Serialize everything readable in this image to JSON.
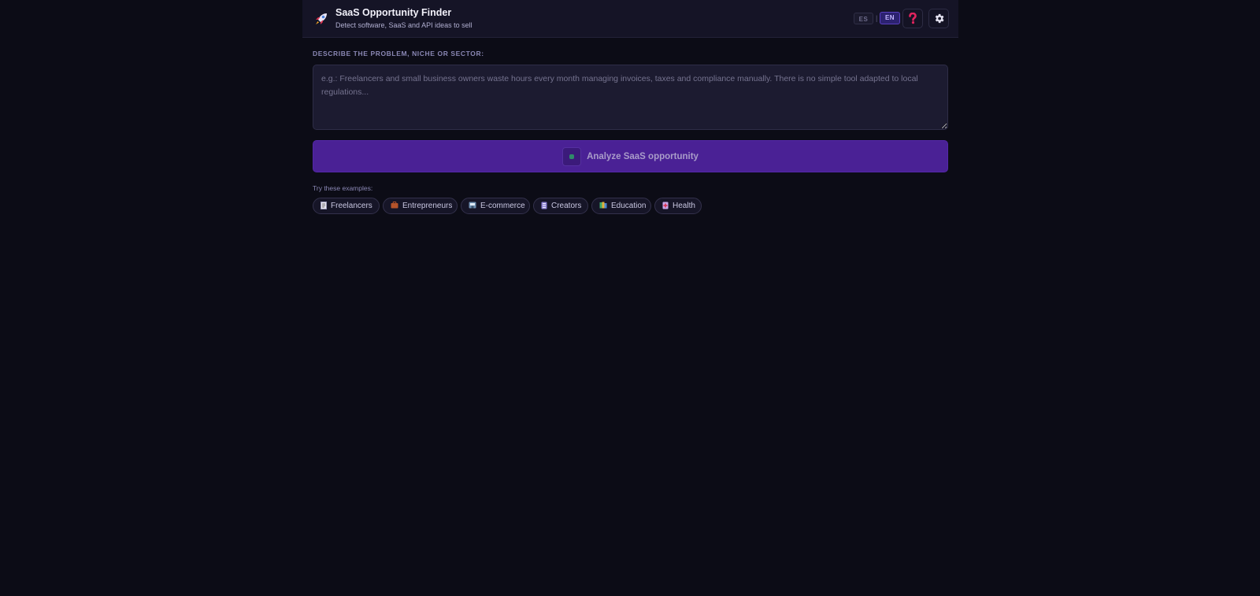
{
  "header": {
    "title": "SaaS Opportunity Finder",
    "subtitle": "Detect software, SaaS and API ideas to sell",
    "logo_icon": "rocket-icon",
    "lang": {
      "es_label": "ES",
      "separator": "|",
      "en_label": "EN",
      "active": "EN"
    },
    "help_icon": "question-mark-icon",
    "settings_icon": "gear-icon"
  },
  "main": {
    "problem_label": "DESCRIBE THE PROBLEM, NICHE OR SECTOR:",
    "problem_value": "",
    "problem_placeholder": "e.g.: Freelancers and small business owners waste hours every month managing invoices, taxes and compliance manually. There is no simple tool adapted to local regulations...",
    "analyze_button": "Analyze SaaS opportunity",
    "examples_label": "Try these examples:",
    "examples": [
      {
        "label": "Freelancers",
        "icon": "receipt-icon"
      },
      {
        "label": "Entrepreneurs",
        "icon": "briefcase-icon"
      },
      {
        "label": "E-commerce",
        "icon": "shop-icon"
      },
      {
        "label": "Creators",
        "icon": "video-icon"
      },
      {
        "label": "Education",
        "icon": "books-icon"
      },
      {
        "label": "Health",
        "icon": "medical-icon"
      }
    ]
  },
  "colors": {
    "background": "#0c0c16",
    "header": "#151426",
    "accent": "#4a2195",
    "help_icon": "#e0245e"
  }
}
